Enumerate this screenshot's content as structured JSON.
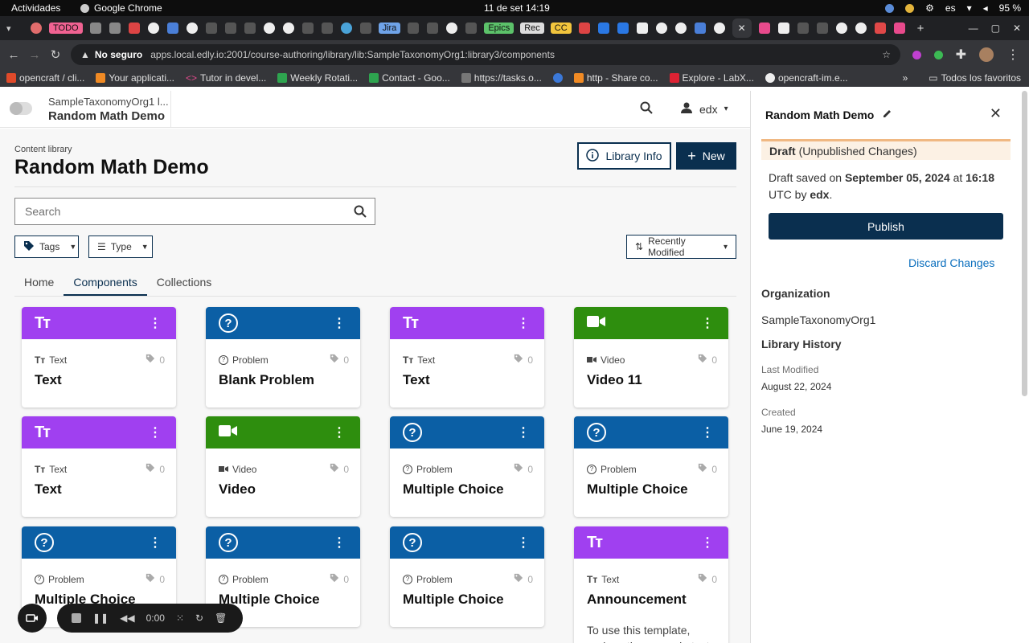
{
  "os": {
    "activities": "Actividades",
    "app_name": "Google Chrome",
    "clock": "11 de set  14:19",
    "lang": "es",
    "battery": "95 %"
  },
  "tabs_strip": {
    "pills": [
      "TODO",
      "Jira",
      "Epics",
      "Rec",
      "CC"
    ]
  },
  "browser": {
    "not_secure": "No seguro",
    "url": "apps.local.edly.io:2001/course-authoring/library/lib:SampleTaxonomyOrg1:library3/components"
  },
  "bookmarks": {
    "items": [
      "opencraft / cli...",
      "Your applicati...",
      "Tutor in devel...",
      "Weekly Rotati...",
      "Contact - Goo...",
      "https://tasks.o...",
      "http - Share co...",
      "Explore - LabX...",
      "opencraft-im.e..."
    ],
    "more": "»",
    "all": "Todos los favoritos"
  },
  "header": {
    "org": "SampleTaxonomyOrg1 l...",
    "title": "Random Math Demo",
    "user": "edx"
  },
  "main": {
    "breadcrumb": "Content library",
    "title": "Random Math Demo",
    "library_info": "Library Info",
    "new": "New",
    "search_placeholder": "Search",
    "tags_filter": "Tags",
    "type_filter": "Type",
    "sort": "Recently Modified",
    "tabs": [
      "Home",
      "Components",
      "Collections"
    ]
  },
  "cards": [
    {
      "type": "Text",
      "title": "Text",
      "tags": "0"
    },
    {
      "type": "Problem",
      "title": "Blank Problem",
      "tags": "0"
    },
    {
      "type": "Text",
      "title": "Text",
      "tags": "0"
    },
    {
      "type": "Video",
      "title": "Video 11",
      "tags": "0"
    },
    {
      "type": "Text",
      "title": "Text",
      "tags": "0"
    },
    {
      "type": "Video",
      "title": "Video",
      "tags": "0"
    },
    {
      "type": "Problem",
      "title": "Multiple Choice",
      "tags": "0"
    },
    {
      "type": "Problem",
      "title": "Multiple Choice",
      "tags": "0"
    },
    {
      "type": "Problem",
      "title": "Multiple Choice",
      "tags": "0"
    },
    {
      "type": "Problem",
      "title": "Multiple Choice",
      "tags": "0"
    },
    {
      "type": "Problem",
      "title": "Multiple Choice",
      "tags": "0"
    },
    {
      "type": "Text",
      "title": "Announcement",
      "tags": "0",
      "description": "To use this template, replace the example text"
    }
  ],
  "colors": {
    "text_type": "#a040f0",
    "problem_type": "#0b5fa5",
    "video_type": "#2e8e0e",
    "primary": "#0a2f4f"
  },
  "side": {
    "title": "Random Math Demo",
    "draft_label": "Draft",
    "draft_note": "(Unpublished Changes)",
    "saved_prefix": "Draft saved on",
    "saved_date": "September 05, 2024",
    "saved_at": "at",
    "saved_time": "16:18",
    "saved_suffix": "UTC by",
    "saved_user": "edx",
    "publish": "Publish",
    "discard": "Discard Changes",
    "org_heading": "Organization",
    "org_value": "SampleTaxonomyOrg1",
    "history_heading": "Library History",
    "last_modified_label": "Last Modified",
    "last_modified_value": "August 22, 2024",
    "created_label": "Created",
    "created_value": "June 19, 2024"
  },
  "recorder": {
    "time": "0:00"
  }
}
